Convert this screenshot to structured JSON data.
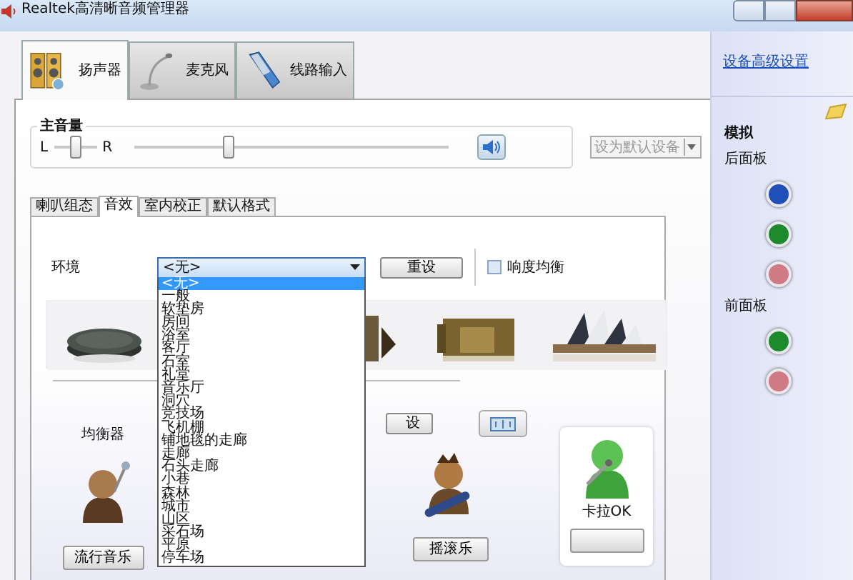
{
  "window": {
    "title": "Realtek高清晰音频管理器"
  },
  "device_tabs": [
    {
      "label": "扬声器",
      "selected": true
    },
    {
      "label": "麦克风",
      "selected": false
    },
    {
      "label": "线路输入",
      "selected": false
    }
  ],
  "master_volume": {
    "label": "主音量",
    "balance": {
      "left": "L",
      "right": "R",
      "level": 0.5
    },
    "volume": {
      "level": 0.3
    }
  },
  "default_device": {
    "label": "设为默认设备",
    "disabled": true
  },
  "sub_tabs": [
    {
      "label": "喇叭组态",
      "selected": false
    },
    {
      "label": "音效",
      "selected": true
    },
    {
      "label": "室内校正",
      "selected": false
    },
    {
      "label": "默认格式",
      "selected": false
    }
  ],
  "environment": {
    "label": "环境",
    "value": "<无>",
    "expanded": true,
    "reset_button": "重设",
    "options": [
      {
        "label": "<无>",
        "selected": true
      },
      {
        "label": "一般",
        "selected": false
      },
      {
        "label": "软垫房",
        "selected": false
      },
      {
        "label": "房间",
        "selected": false
      },
      {
        "label": "浴室",
        "selected": false
      },
      {
        "label": "客厅",
        "selected": false
      },
      {
        "label": "石室",
        "selected": false
      },
      {
        "label": "礼堂",
        "selected": false
      },
      {
        "label": "音乐厅",
        "selected": false
      },
      {
        "label": "洞穴",
        "selected": false
      },
      {
        "label": "竞技场",
        "selected": false
      },
      {
        "label": "飞机棚",
        "selected": false
      },
      {
        "label": "铺地毯的走廊",
        "selected": false
      },
      {
        "label": "走廊",
        "selected": false
      },
      {
        "label": "石头走廊",
        "selected": false
      },
      {
        "label": "小巷",
        "selected": false
      },
      {
        "label": "森林",
        "selected": false
      },
      {
        "label": "城市",
        "selected": false
      },
      {
        "label": "山区",
        "selected": false
      },
      {
        "label": "采石场",
        "selected": false
      },
      {
        "label": "平原",
        "selected": false
      },
      {
        "label": "停车场",
        "selected": false
      }
    ]
  },
  "loudness": {
    "label": "响度均衡",
    "checked": false
  },
  "equalizer": {
    "label": "均衡器",
    "reset_button": "设"
  },
  "presets": [
    {
      "label": "流行音乐"
    },
    {
      "label": "摇滚乐"
    }
  ],
  "karaoke": {
    "label": "卡拉OK"
  },
  "sidebar": {
    "link": "设备高级设置",
    "section": "模拟",
    "panels": [
      {
        "label": "后面板",
        "jacks": [
          {
            "color": "#1f4fb8"
          },
          {
            "color": "#1e8a2e"
          },
          {
            "color": "#d07a86"
          }
        ]
      },
      {
        "label": "前面板",
        "jacks": [
          {
            "color": "#1e8a2e"
          },
          {
            "color": "#d07a86"
          }
        ]
      }
    ]
  }
}
